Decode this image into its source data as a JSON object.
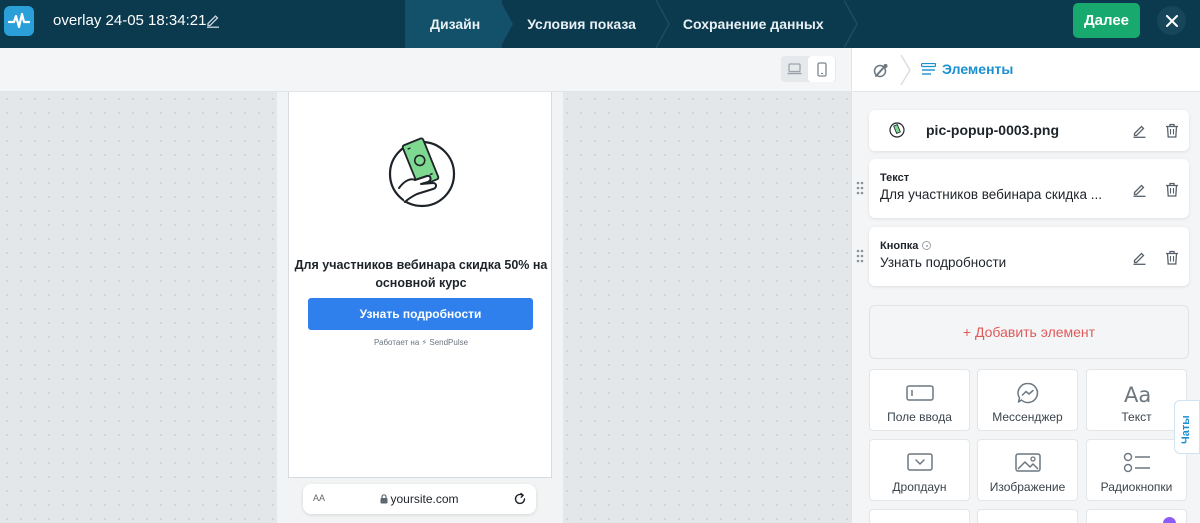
{
  "topbar": {
    "title": "overlay 24-05 18:34:21",
    "steps": [
      {
        "label": "Дизайн",
        "active": true
      },
      {
        "label": "Условия показа",
        "active": false
      },
      {
        "label": "Сохранение данных",
        "active": false
      }
    ],
    "next_label": "Далее",
    "colors": {
      "bg": "#0b3a4f",
      "active_step": "#13506a",
      "next": "#17a96d"
    }
  },
  "canvas": {
    "device_modes": [
      "desktop-icon",
      "mobile-icon"
    ],
    "selected_device": "mobile-icon",
    "popup": {
      "text": "Для участников вебинара скидка 50% на основной курс",
      "button_label": "Узнать подробности",
      "button_color": "#2f80ed",
      "powered_by": "Работает на ⚡ SendPulse"
    },
    "browser": {
      "aa_label": "AA",
      "url": "yoursite.com"
    }
  },
  "panel": {
    "breadcrumb_label": "Элементы",
    "elements": [
      {
        "type": "",
        "value": "pic-popup-0003.png"
      },
      {
        "type": "Текст",
        "value": "Для участников вебинара скидка ..."
      },
      {
        "type": "Кнопка",
        "value": "Узнать подробности"
      }
    ],
    "add_label": "+ Добавить элемент",
    "tiles": [
      {
        "label": "Поле ввода",
        "icon": "input-field-icon"
      },
      {
        "label": "Мессенджер",
        "icon": "messenger-icon"
      },
      {
        "label": "Текст",
        "icon": "text-icon"
      },
      {
        "label": "Дропдаун",
        "icon": "dropdown-icon"
      },
      {
        "label": "Изображение",
        "icon": "image-icon"
      },
      {
        "label": "Радиокнопки",
        "icon": "radio-buttons-icon"
      }
    ],
    "chats_tab": "Чаты"
  }
}
